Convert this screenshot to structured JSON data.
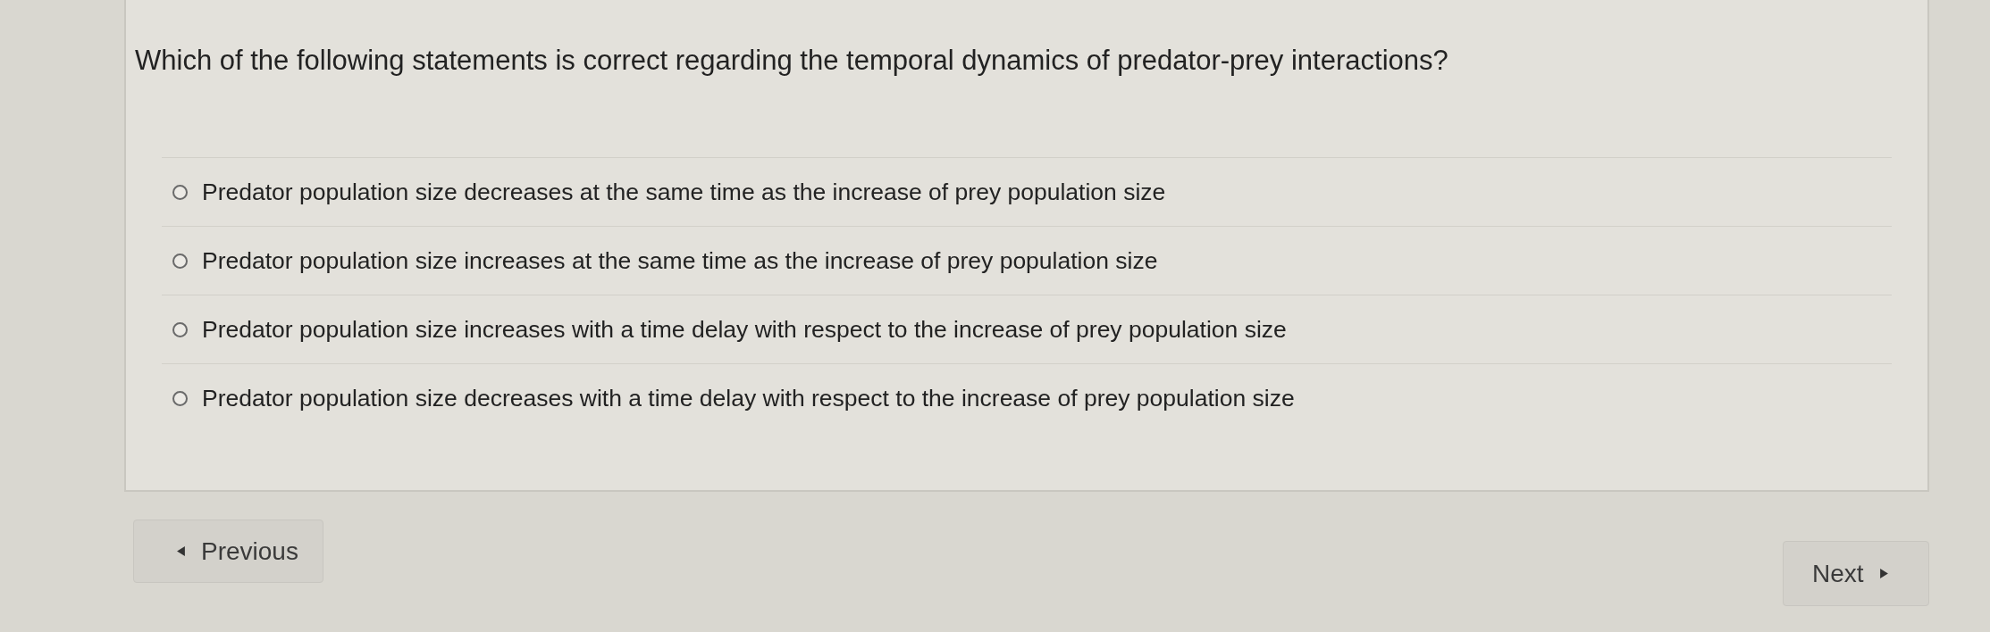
{
  "question": "Which of the following statements is correct regarding the temporal dynamics of predator-prey interactions?",
  "options": [
    {
      "label": "Predator population size decreases at the same time as the increase of prey population size",
      "selected": false
    },
    {
      "label": "Predator population size increases at the same time as the increase of prey population size",
      "selected": false
    },
    {
      "label": "Predator population size increases with a time delay with respect to the increase of prey population size",
      "selected": false
    },
    {
      "label": "Predator population size decreases with a time delay with respect to the increase of prey population size",
      "selected": false
    }
  ],
  "navigation": {
    "previous": "Previous",
    "next": "Next"
  }
}
